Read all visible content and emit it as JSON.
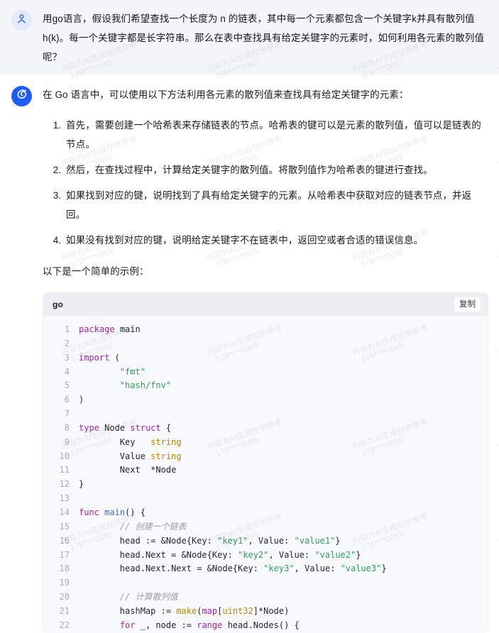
{
  "conversation": {
    "user_message": {
      "avatar_icon": "user-person-icon",
      "text": "用go语言，假设我们希望查找一个长度为 n 的链表，其中每一个元素都包含一个关键字k并具有散列值h(k)。每一个关键字都是长字符串。那么在表中查找具有给定关键字的元素时，如何利用各元素的散列值呢？"
    },
    "assistant_message": {
      "avatar_icon": "assistant-swirl-icon",
      "intro": "在 Go 语言中，可以使用以下方法利用各元素的散列值来查找具有给定关键字的元素：",
      "steps": [
        "首先，需要创建一个哈希表来存储链表的节点。哈希表的键可以是元素的散列值，值可以是链表的节点。",
        "然后，在查找过程中，计算给定关键字的散列值。将散列值作为哈希表的键进行查找。",
        "如果找到对应的键，说明找到了具有给定关键字的元素。从哈希表中获取对应的链表节点，并返回。",
        "如果没有找到对应的键，说明给定关键字不在链表中，返回空或者合适的错误信息。"
      ],
      "example_lead": "以下是一个简单的示例："
    }
  },
  "code_block": {
    "language_label": "go",
    "copy_label": "复制",
    "lines": [
      {
        "n": "1",
        "text": "package main"
      },
      {
        "n": "2",
        "text": ""
      },
      {
        "n": "3",
        "text": "import ("
      },
      {
        "n": "4",
        "text": "        \"fmt\""
      },
      {
        "n": "5",
        "text": "        \"hash/fnv\""
      },
      {
        "n": "6",
        "text": ")"
      },
      {
        "n": "7",
        "text": ""
      },
      {
        "n": "8",
        "text": "type Node struct {"
      },
      {
        "n": "9",
        "text": "        Key   string"
      },
      {
        "n": "10",
        "text": "        Value string"
      },
      {
        "n": "11",
        "text": "        Next  *Node"
      },
      {
        "n": "12",
        "text": "}"
      },
      {
        "n": "13",
        "text": ""
      },
      {
        "n": "14",
        "text": "func main() {"
      },
      {
        "n": "15",
        "text": "        // 创建一个链表"
      },
      {
        "n": "16",
        "text": "        head := &Node{Key: \"key1\", Value: \"value1\"}"
      },
      {
        "n": "17",
        "text": "        head.Next = &Node{Key: \"key2\", Value: \"value2\"}"
      },
      {
        "n": "18",
        "text": "        head.Next.Next = &Node{Key: \"key3\", Value: \"value3\"}"
      },
      {
        "n": "19",
        "text": ""
      },
      {
        "n": "20",
        "text": "        // 计算散列值"
      },
      {
        "n": "21",
        "text": "        hashMap := make(map[uint32]*Node)"
      },
      {
        "n": "22",
        "text": "        for _, node := range head.Nodes() {"
      }
    ]
  },
  "watermark": {
    "line1": "内容为AI生成仅供参考",
    "line2": "178****0065"
  },
  "colors": {
    "user_bg": "#f4f5f8",
    "assistant_bg": "#ffffff",
    "avatar_user_bg": "#e3eafb",
    "avatar_assistant_bg": "#1d5cf5",
    "code_header_bg": "#eceef4",
    "code_body_bg": "#f8f9fd",
    "keyword": "#a626a4",
    "string": "#2e9e57",
    "type": "#c18401",
    "function": "#3f6ddb",
    "comment": "#9b9ba8"
  }
}
